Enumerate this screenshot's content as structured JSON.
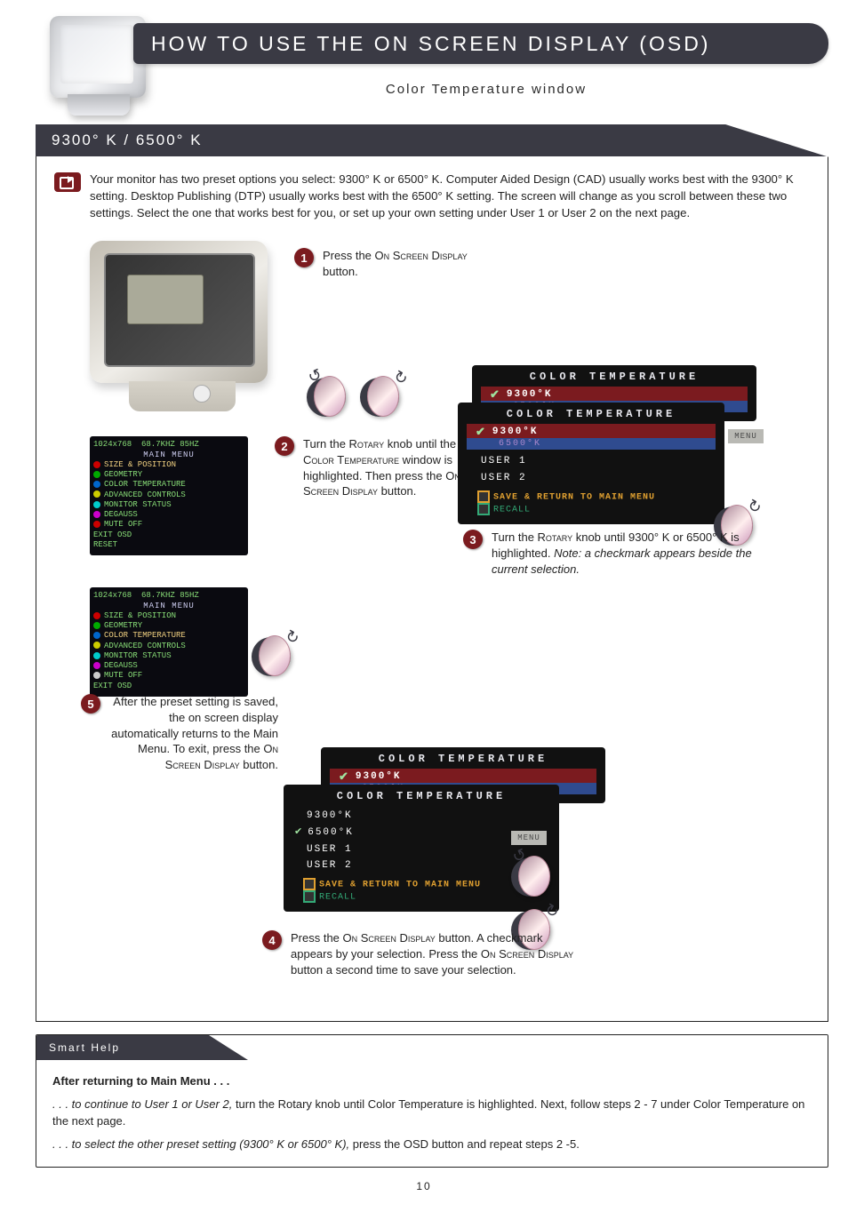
{
  "header": {
    "title": "How to Use the On Screen Display (OSD)",
    "subtitle": "Color Temperature window"
  },
  "section": {
    "tab_title": "9300° K / 6500° K",
    "intro": "Your monitor has two preset options you select: 9300° K or 6500° K. Computer Aided Design (CAD) usually works best with the 9300° K setting. Desktop Publishing (DTP) usually works best with the 6500° K setting. The screen will change as you scroll between these two settings. Select the one that works best for you, or set up your own setting under User 1 or User 2 on the next page."
  },
  "steps": {
    "s1": {
      "num": "1",
      "text_a": "Press the ",
      "text_b": "On Screen Display",
      "text_c": " button."
    },
    "s2": {
      "num": "2",
      "text_a": "Turn the ",
      "text_b": "Rotary",
      "text_c": " knob until the ",
      "text_d": "Color Temperature",
      "text_e": " window is highlighted. Then press the ",
      "text_f": "On Screen Display",
      "text_g": " button."
    },
    "s3": {
      "num": "3",
      "text_a": "Turn the ",
      "text_b": "Rotary",
      "text_c": " knob until 9300° K or 6500° K is highlighted. ",
      "note": "Note: a checkmark appears beside the current selection."
    },
    "s4": {
      "num": "4",
      "text_a": "Press the ",
      "text_b": "On Screen Display",
      "text_c": " button. A checkmark appears by your selection. Press the ",
      "text_d": "On Screen Display",
      "text_e": " button a second time to save your selection."
    },
    "s5": {
      "num": "5",
      "text_a": "After the preset setting is saved, the on screen display automatically returns to the Main Menu. To exit, press the ",
      "text_b": "On Screen Display",
      "text_c": " button."
    }
  },
  "osd_menu": {
    "res_line": "1024x768  68.7KHZ 85HZ",
    "title": "MAIN MENU",
    "items": [
      "SIZE & POSITION",
      "GEOMETRY",
      "COLOR TEMPERATURE",
      "ADVANCED CONTROLS",
      "MONITOR STATUS",
      "DEGAUSS",
      "MUTE OFF",
      "EXIT OSD",
      "RESET"
    ],
    "sel_default": "SIZE & POSITION",
    "sel_color": "COLOR TEMPERATURE"
  },
  "ct_panel": {
    "title": "COLOR TEMPERATURE",
    "opt_9300": "9300°K",
    "opt_6500": "6500°K",
    "opt_u1": "USER 1",
    "opt_u2": "USER 2",
    "save": "SAVE & RETURN TO MAIN MENU",
    "recall": "RECALL",
    "menu_label": "MENU"
  },
  "smart_help": {
    "tab": "Smart Help",
    "lead": "After returning to Main Menu . . .",
    "line1_i": ". . . to continue to User 1 or User 2, ",
    "line1_r": "turn the Rotary knob until Color Temperature is highlighted. Next, follow steps 2 - 7 under Color Temperature on the next page.",
    "line2_i": ". . . to select the other preset setting (9300° K or 6500° K), ",
    "line2_r": "press the OSD button and repeat steps 2 -5."
  },
  "page_number": "10"
}
